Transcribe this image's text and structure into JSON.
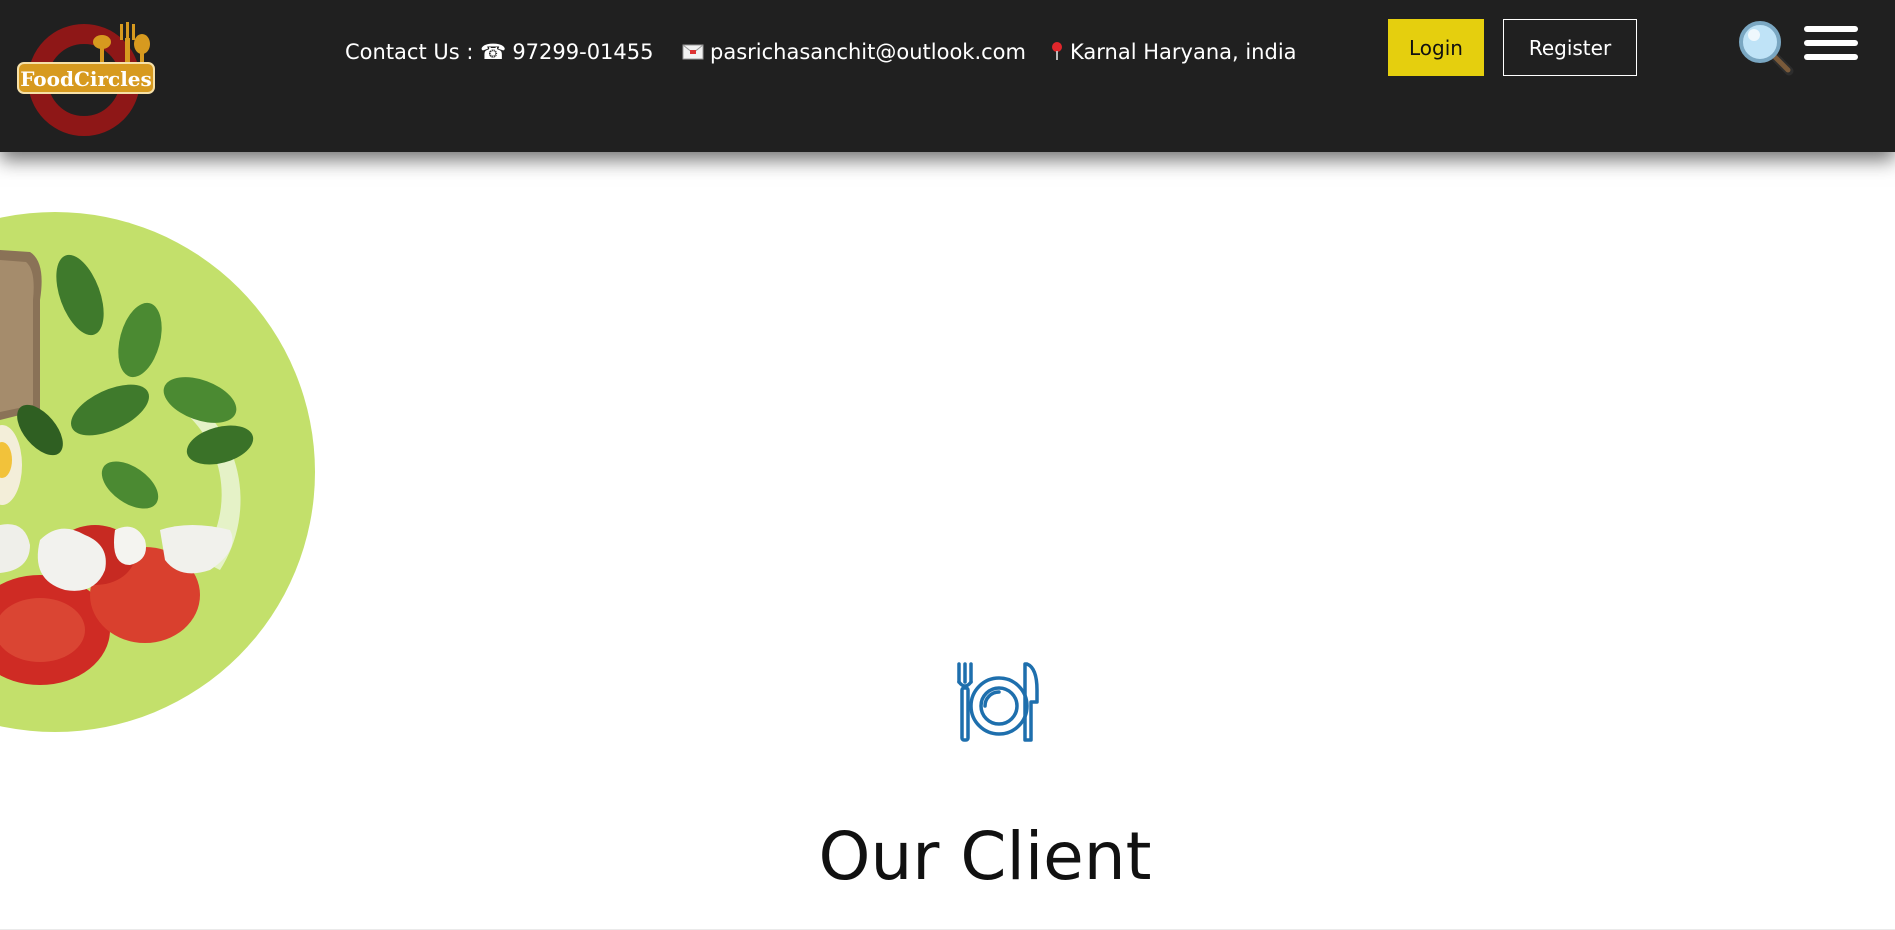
{
  "brand": {
    "logo_text": "FoodCircles"
  },
  "header": {
    "contact_label": "Contact Us :",
    "phone": "97299-01455",
    "email": "pasrichasanchit@outlook.com",
    "location": "Karnal Haryana, india",
    "login_label": "Login",
    "register_label": "Register"
  },
  "icons": {
    "phone": "phone-icon",
    "email": "envelope-icon",
    "location": "map-pin-icon",
    "search": "search-icon",
    "menu": "hamburger-menu-icon",
    "section": "plate-fork-knife-icon"
  },
  "section": {
    "title": "Our Client"
  },
  "colors": {
    "header_bg": "#202020",
    "login_bg": "#e5cf0e",
    "accent_blue": "#1e6fad",
    "plate_green": "#c3e06b"
  }
}
